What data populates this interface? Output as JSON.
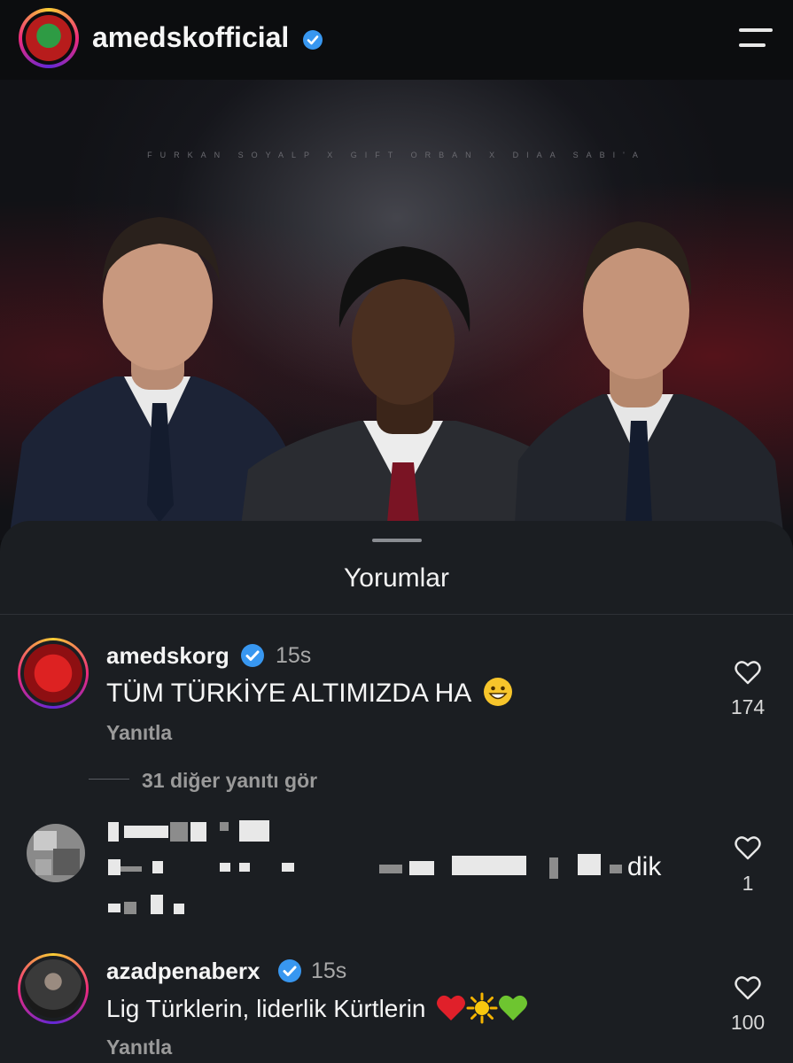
{
  "header": {
    "username": "amedskofficial"
  },
  "post": {
    "credits_line": "FURKAN SOYALP X GIFT ORBAN X DIAA SABI'A"
  },
  "comments_sheet": {
    "title": "Yorumlar",
    "comments": [
      {
        "username": "amedskorg",
        "time": "15s",
        "text": "TÜM TÜRKİYE ALTIMIZDA HA",
        "reply_label": "Yanıtla",
        "like_count": "174",
        "view_replies": "31 diğer yanıtı gör"
      },
      {
        "username": "",
        "text_visible_fragment": "dik",
        "like_count": "1"
      },
      {
        "username": "azadpenaberx",
        "time": "15s",
        "text": "Lig Türklerin, liderlik Kürtlerin",
        "reply_label": "Yanıtla",
        "like_count": "100"
      }
    ]
  },
  "colors": {
    "verified_blue": "#3897f0",
    "sheet_bg": "#1b1e22",
    "background": "#0d0e10"
  },
  "icons": [
    "menu-icon",
    "verified-badge-icon",
    "heart-icon",
    "grinning-face-emoji",
    "red-heart-emoji",
    "sun-emoji",
    "green-heart-emoji"
  ]
}
